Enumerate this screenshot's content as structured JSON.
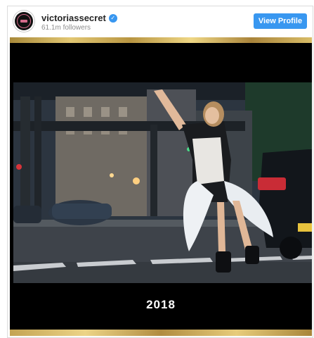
{
  "profile": {
    "username": "victoriassecret",
    "followers": "61.1m followers",
    "verified": true,
    "view_profile_label": "View Profile"
  },
  "post": {
    "caption_year": "2018"
  },
  "colors": {
    "accent": "#3897f0",
    "gold": "#d9bd68",
    "frame": "#000000"
  }
}
